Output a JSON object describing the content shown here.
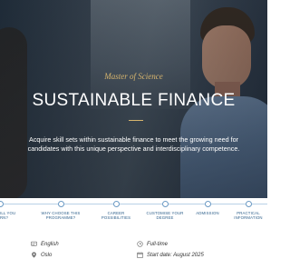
{
  "hero": {
    "subtitle": "Master of Science",
    "title": "SUSTAINABLE FINANCE",
    "description": "Acquire skill sets within sustainable finance to meet the growing need for candidates with this unique perspective and interdisciplinary competence."
  },
  "progress": {
    "steps": [
      {
        "label": "ILL YOU\nRN?"
      },
      {
        "label": "WHY CHOOSE THIS\nPROGRAMME?"
      },
      {
        "label": "CAREER\nPOSSIBILITIES"
      },
      {
        "label": "CUSTOMISE YOUR\nDEGREE"
      },
      {
        "label": "ADMISSION"
      },
      {
        "label": "PRACTICAL\nINFORMATION"
      }
    ]
  },
  "info": {
    "language": "English",
    "location": "Oslo",
    "pace": "Full-time",
    "start": "Start date: August 2025",
    "icons": {
      "language": "language-icon",
      "location": "location-pin-icon",
      "pace": "clock-icon",
      "start": "calendar-icon"
    }
  },
  "colors": {
    "accent_gold": "#d7b56e",
    "nav_blue": "#2d5f8a",
    "nav_line": "#b9d1e6"
  }
}
